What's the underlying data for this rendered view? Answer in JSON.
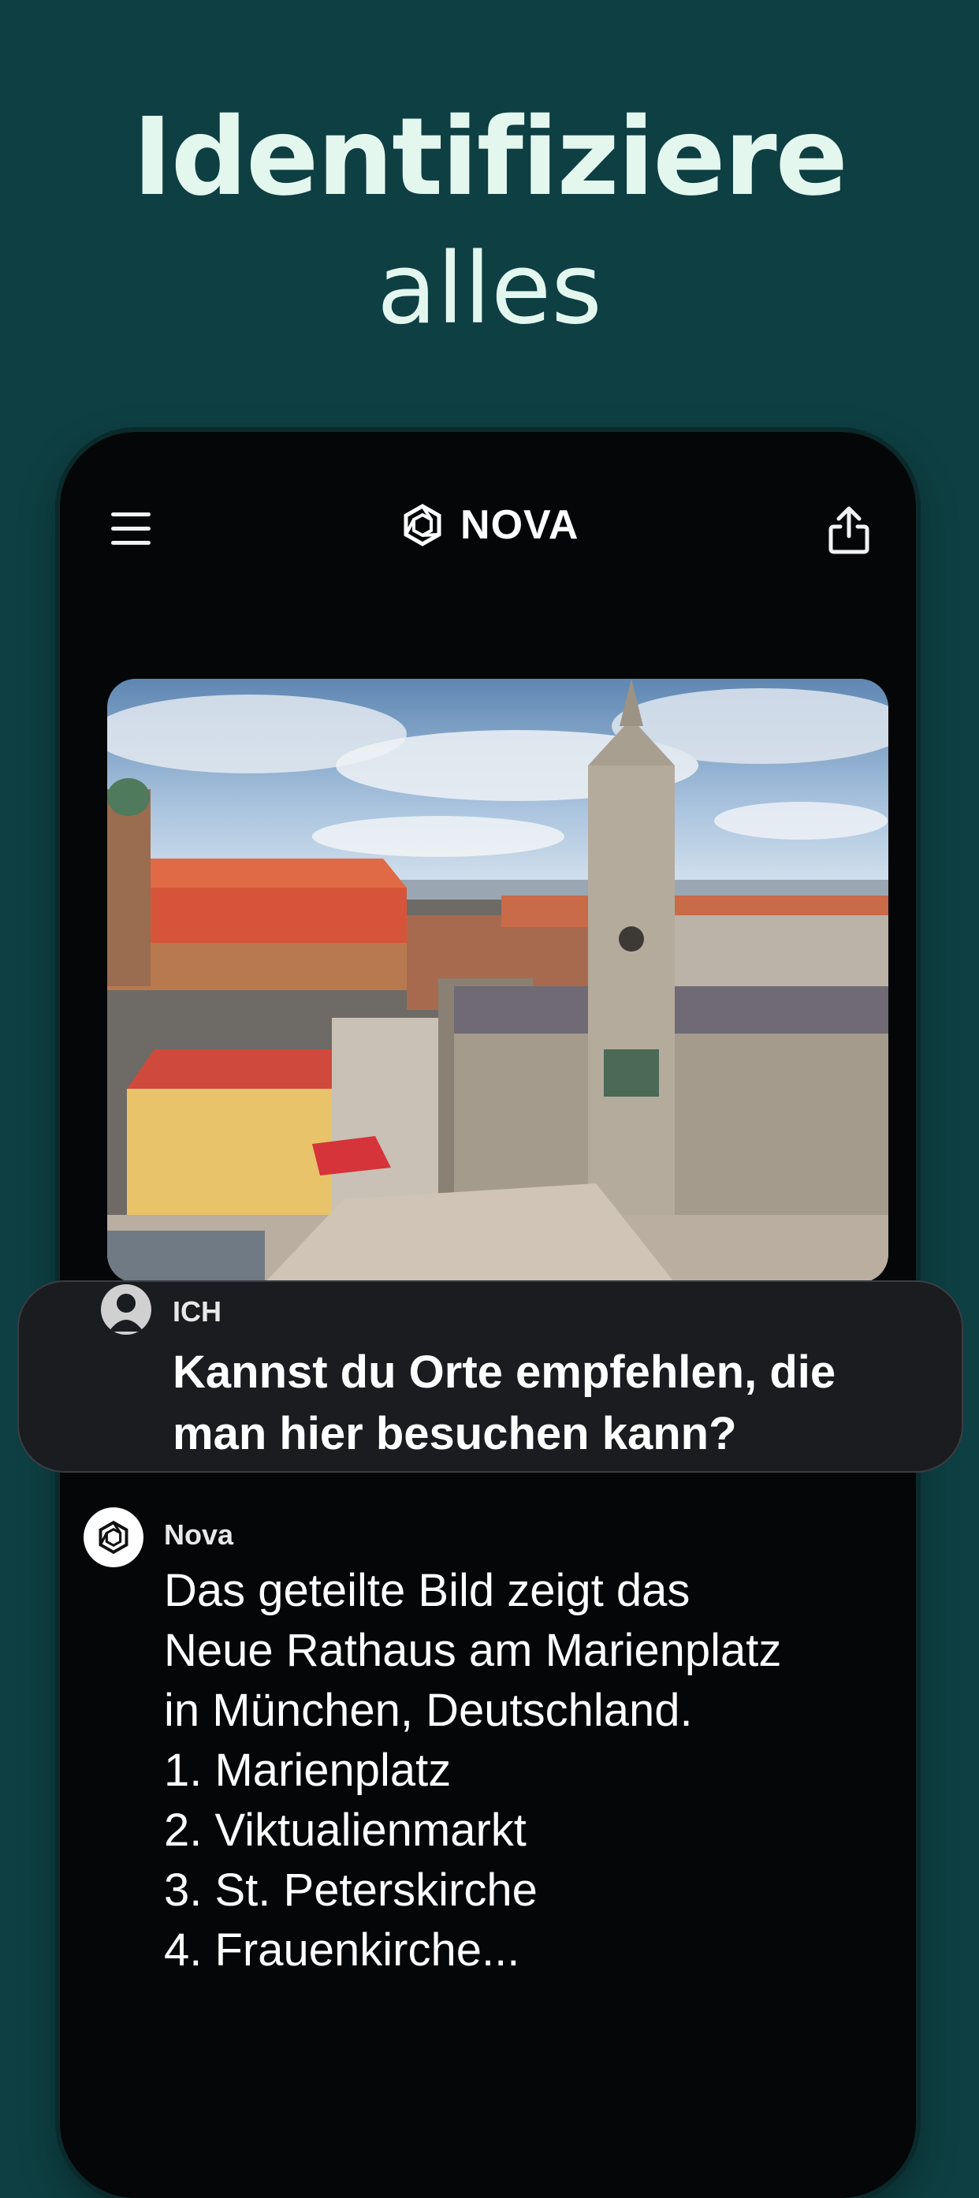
{
  "headline": {
    "line1": "Identifiziere",
    "line2": "alles"
  },
  "app": {
    "name": "NOVA"
  },
  "icons": {
    "menu": "menu-icon",
    "logo": "nova-logo-icon",
    "share": "share-icon",
    "user": "user-avatar-icon"
  },
  "user_message": {
    "sender": "ICH",
    "text": "Kannst du Orte empfehlen, die man hier besuchen kann?"
  },
  "assistant_message": {
    "sender": "Nova",
    "lines": [
      "Das geteilte Bild zeigt das",
      "Neue Rathaus am Marienplatz",
      "in München, Deutschland.",
      "1. Marienplatz",
      "2. Viktualienmarkt",
      "3. St. Peterskirche",
      "4. Frauenkirche..."
    ]
  },
  "colors": {
    "background": "#0e3f42",
    "headline": "#e3f7ef",
    "phone": "#050607",
    "bubble": "#1a1c20"
  }
}
